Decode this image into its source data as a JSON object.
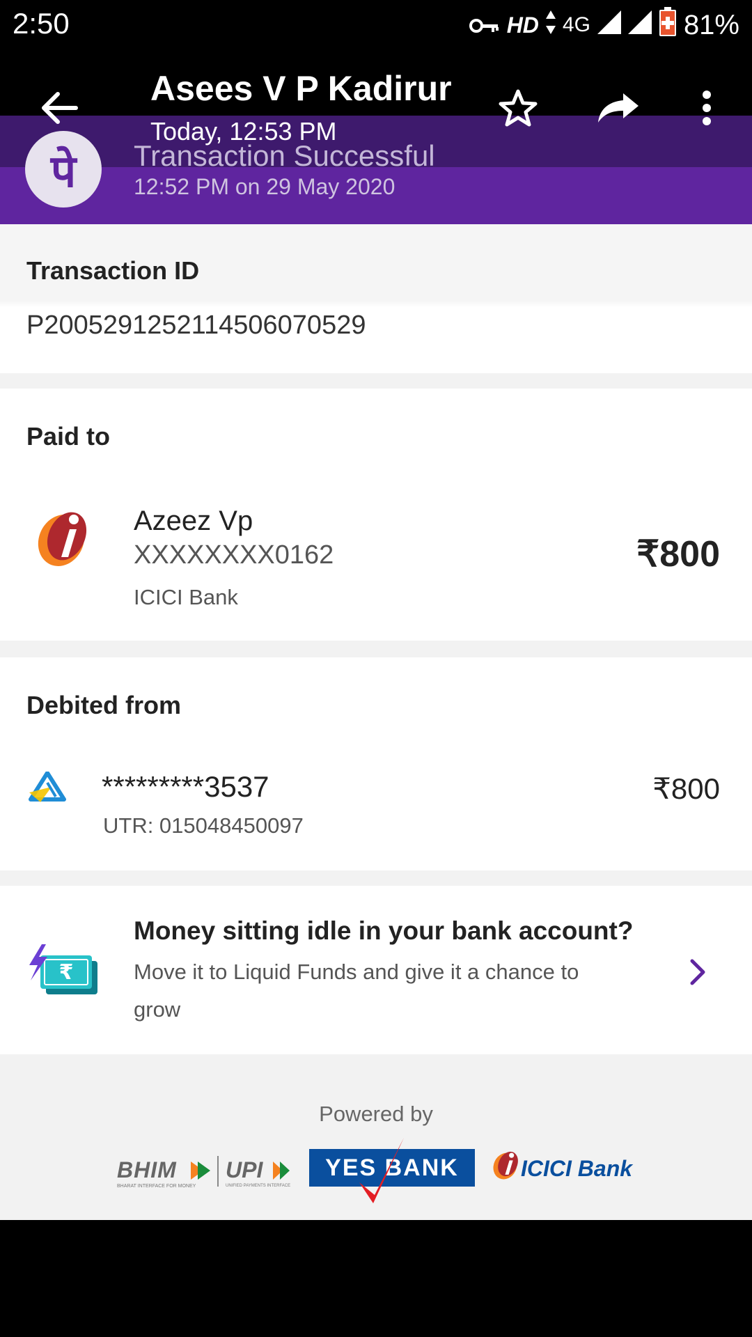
{
  "status_bar": {
    "time": "2:50",
    "hd": "HD",
    "network": "4G",
    "battery": "81%"
  },
  "app_bar": {
    "title": "Asees V P Kadirur",
    "subtitle": "Today, 12:53 PM"
  },
  "banner": {
    "logo_glyph": "पे",
    "status": "Transaction Successful",
    "datetime": "12:52 PM on 29 May 2020"
  },
  "transaction": {
    "label": "Transaction ID",
    "id": "P2005291252114506070529"
  },
  "paid_to": {
    "label": "Paid to",
    "name": "Azeez Vp",
    "account": "XXXXXXXX0162",
    "bank": "ICICI Bank",
    "amount": "₹800"
  },
  "debited_from": {
    "label": "Debited from",
    "account": "*********3537",
    "utr": "UTR: 015048450097",
    "amount": "₹800"
  },
  "promo": {
    "title": "Money sitting idle in your bank account?",
    "text_line1": "Move it to Liquid Funds and give it a chance to",
    "text_line2": "grow",
    "icon_glyph": "₹"
  },
  "footer": {
    "powered_by": "Powered by",
    "bhim": "BHIM",
    "upi": "UPI",
    "bhim_tagline": "BHARAT INTERFACE FOR MONEY",
    "upi_tagline": "UNIFIED PAYMENTS INTERFACE",
    "yes_bank": "YES BANK",
    "icici_logo_text": "ICICI Bank"
  },
  "colors": {
    "brand_purple": "#5f259f",
    "dark_purple": "#3e1a6d",
    "yes_blue": "#0a4f9e",
    "icici_orange": "#f58220",
    "icici_red": "#ae282e",
    "sbi_blue": "#1f8dd6",
    "sbi_yellow": "#f5c400"
  }
}
